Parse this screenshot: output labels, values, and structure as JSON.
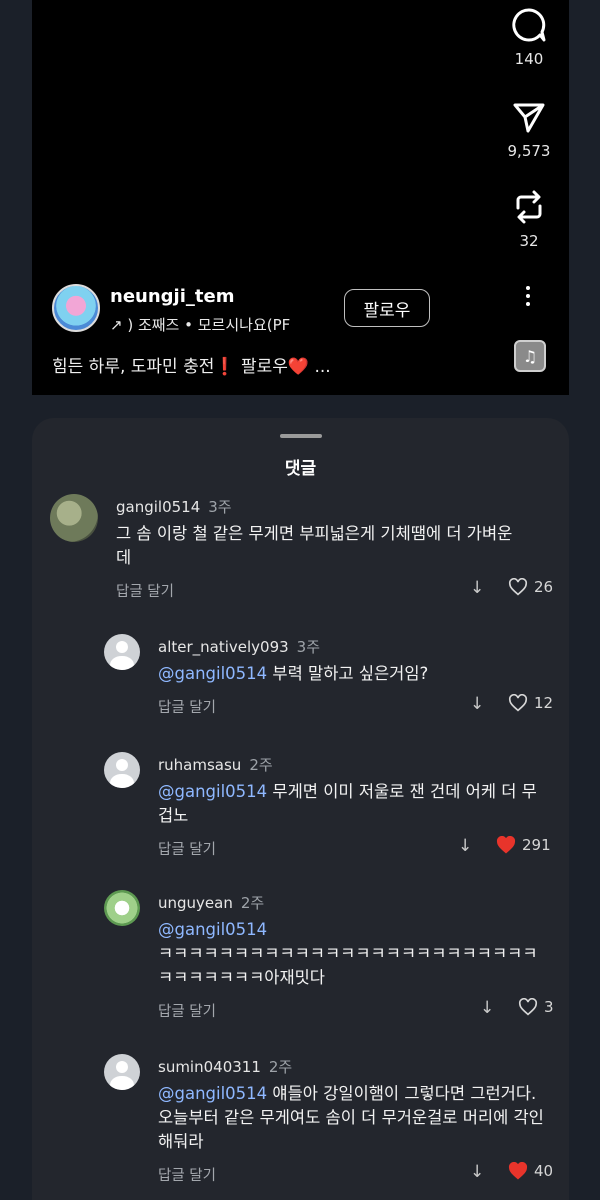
{
  "video": {
    "actions": [
      {
        "icon": "comment-icon",
        "count": "140"
      },
      {
        "icon": "send-icon",
        "count": "9,573"
      },
      {
        "icon": "repost-icon",
        "count": "32"
      }
    ],
    "author": {
      "username": "neungji_tem",
      "music_meta": "↗ )  조째즈 • 모르시나요(PF",
      "follow_label": "팔로우"
    },
    "caption": {
      "text": "힘든 하루, 도파민 충전",
      "mark": "❗",
      "follow_word": " 팔로우",
      "heart": "❤️",
      "ellipsis": " ..."
    },
    "music_icon": "music-note-icon"
  },
  "comments_sheet": {
    "title": "댓글",
    "reply_label": "답글 달기",
    "comments": [
      {
        "user": "gangil0514",
        "ago": "3주",
        "mention": "",
        "text": "그 솜 이랑 철 같은 무게면 부피넓은게 기체땜에 더 가벼운데",
        "likes": "26",
        "liked": false
      },
      {
        "user": "alter_natively093",
        "ago": "3주",
        "mention": "@gangil0514",
        "text": " 부력 말하고 싶은거임?",
        "likes": "12",
        "liked": false
      },
      {
        "user": "ruhamsasu",
        "ago": "2주",
        "mention": "@gangil0514",
        "text": " 무게면 이미 저울로 잰 건데 어케 더 무겁노",
        "likes": "291",
        "liked": true
      },
      {
        "user": "unguyean",
        "ago": "2주",
        "mention": "@gangil0514",
        "text": "ㅋㅋㅋㅋㅋㅋㅋㅋㅋㅋㅋㅋㅋㅋㅋㅋㅋㅋㅋㅋㅋㅋㅋㅋㅋㅋㅋㅋㅋㅋㅋㅋ아재밋다",
        "likes": "3",
        "liked": false
      },
      {
        "user": "sumin040311",
        "ago": "2주",
        "mention": "@gangil0514",
        "text": " 얘들아 강일이햄이 그렇다면 그런거다. 오늘부터 같은 무게여도 솜이 더 무거운걸로 머리에 각인해둬라",
        "likes": "40",
        "liked": true
      }
    ]
  },
  "colors": {
    "background": "#1b2029",
    "sheet": "#23262d",
    "mention": "#8fb8ff",
    "liked_heart": "#e8342b"
  }
}
